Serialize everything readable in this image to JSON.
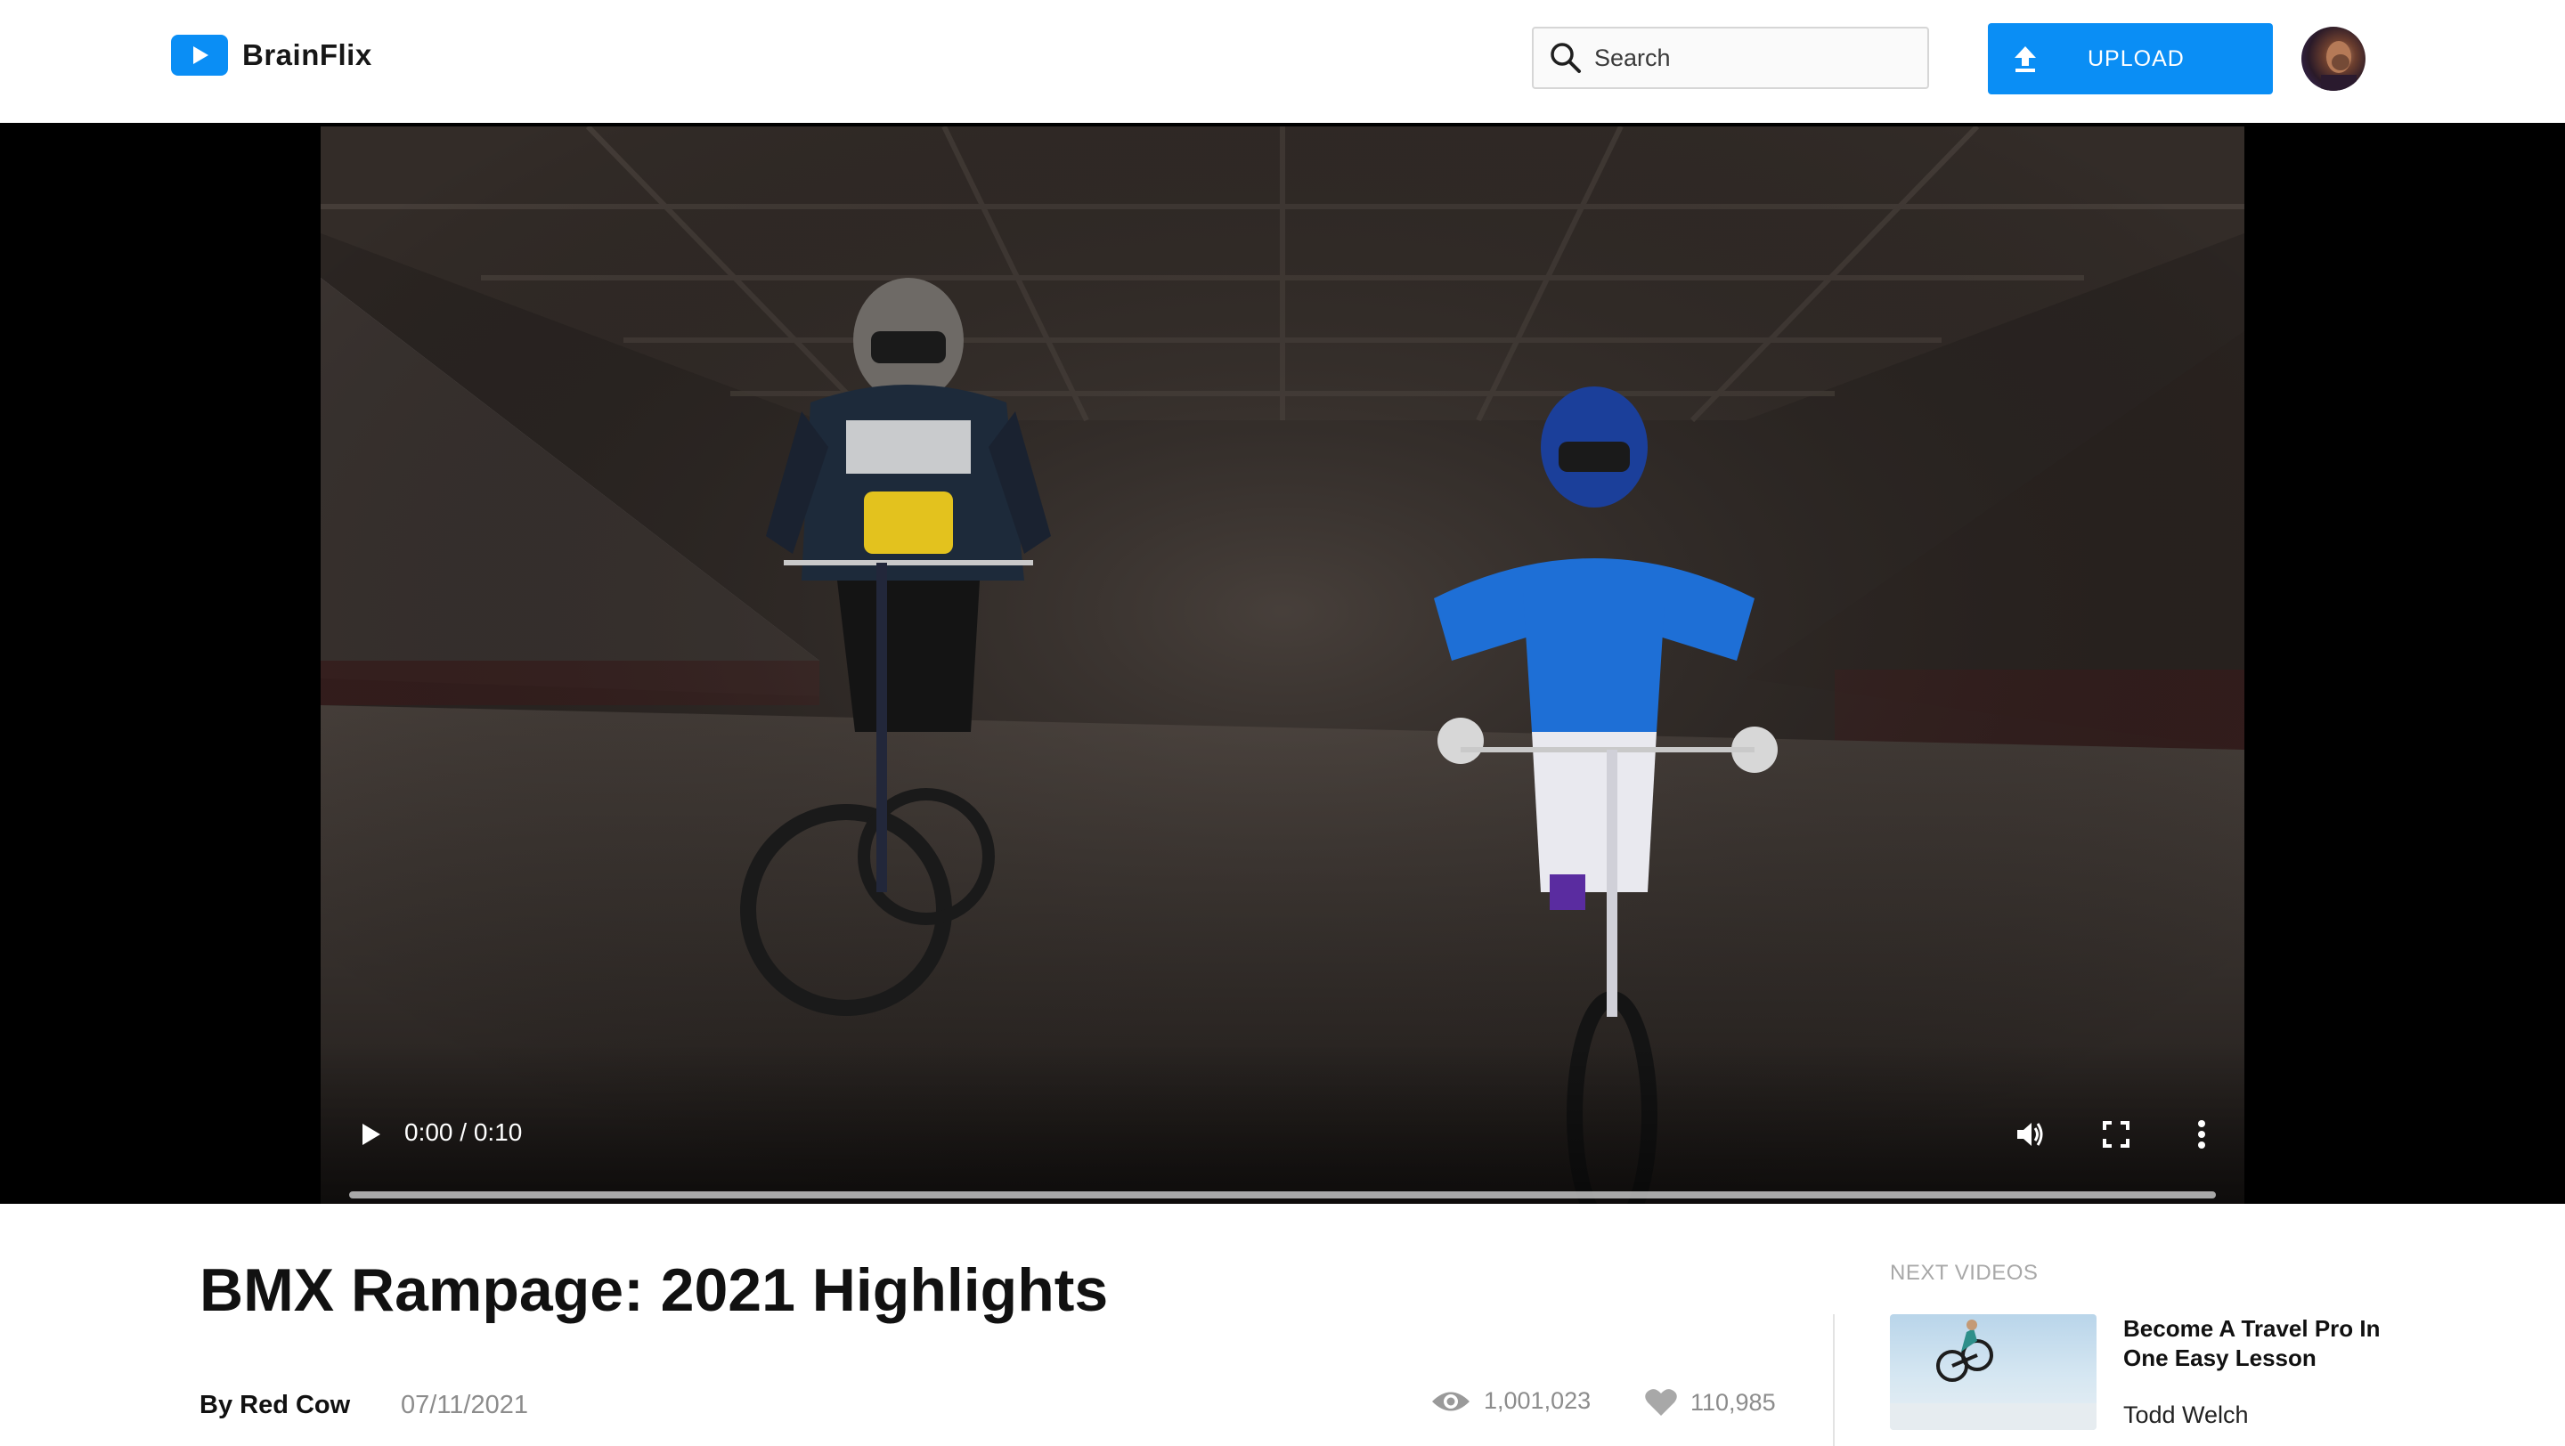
{
  "app": {
    "name": "BrainFlix",
    "logo_icon": "play-icon",
    "brand_color": "#0A8EF5"
  },
  "header": {
    "search": {
      "placeholder": "Search",
      "value": "",
      "icon": "search-icon"
    },
    "upload_label": "UPLOAD",
    "upload_icon": "upload-icon",
    "avatar_icon": "user-avatar"
  },
  "player": {
    "time": "0:00 / 0:10",
    "progress": 0,
    "controls": [
      "play-icon",
      "volume-icon",
      "fullscreen-icon",
      "more-vertical-icon"
    ]
  },
  "video": {
    "title": "BMX Rampage: 2021 Highlights",
    "author": "By Red Cow",
    "date": "07/11/2021",
    "views": "1,001,023",
    "likes": "110,985",
    "views_icon": "eye-icon",
    "likes_icon": "heart-icon"
  },
  "next_videos": {
    "heading": "NEXT VIDEOS",
    "items": [
      {
        "title": "Become A Travel Pro In One Easy Lesson",
        "author": "Todd Welch"
      }
    ]
  }
}
